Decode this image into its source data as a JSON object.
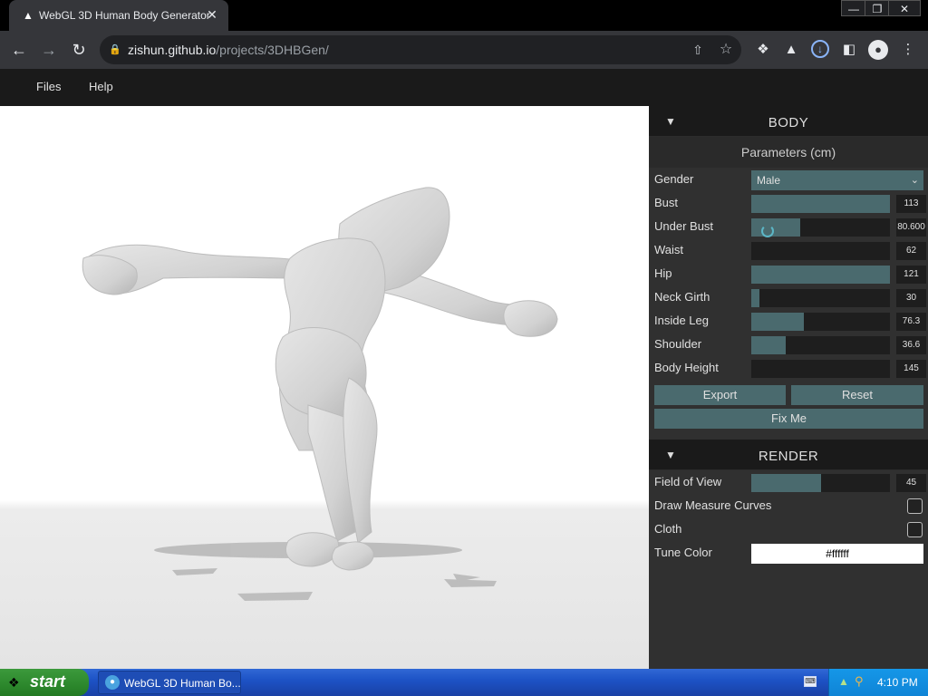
{
  "browser": {
    "tab_title": "WebGL 3D Human Body Generator",
    "url_host": "zishun.github.io",
    "url_path": "/projects/3DHBGen/"
  },
  "menubar": {
    "files": "Files",
    "help": "Help"
  },
  "gui": {
    "body_folder": "BODY",
    "parameters_title": "Parameters (cm)",
    "gender": {
      "label": "Gender",
      "value": "Male"
    },
    "sliders": [
      {
        "label": "Bust",
        "value": "113",
        "fill": 1.0
      },
      {
        "label": "Under Bust",
        "value": "80.600",
        "fill": 0.35
      },
      {
        "label": "Waist",
        "value": "62",
        "fill": 0.0
      },
      {
        "label": "Hip",
        "value": "121",
        "fill": 1.0
      },
      {
        "label": "Neck Girth",
        "value": "30",
        "fill": 0.06
      },
      {
        "label": "Inside Leg",
        "value": "76.3",
        "fill": 0.38
      },
      {
        "label": "Shoulder",
        "value": "36.6",
        "fill": 0.25
      },
      {
        "label": "Body Height",
        "value": "145",
        "fill": 0.0
      }
    ],
    "export_label": "Export",
    "reset_label": "Reset",
    "fixme_label": "Fix Me",
    "render_folder": "RENDER",
    "fov": {
      "label": "Field of View",
      "value": "45",
      "fill": 0.5
    },
    "draw_curves_label": "Draw Measure Curves",
    "cloth_label": "Cloth",
    "tune_color": {
      "label": "Tune Color",
      "value": "#ffffff"
    }
  },
  "taskbar": {
    "start_label": "start",
    "task_label": "WebGL 3D Human Bo...",
    "clock": "4:10 PM"
  }
}
